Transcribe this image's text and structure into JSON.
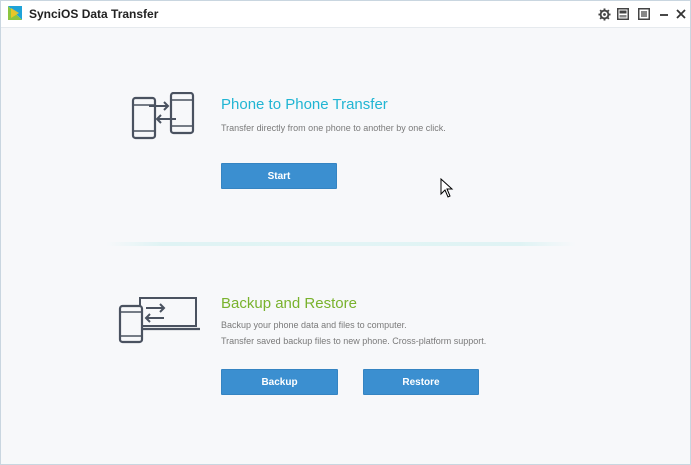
{
  "window": {
    "title": "SynciOS Data Transfer"
  },
  "titlebar_controls": {
    "icons": [
      "gear-icon",
      "skin-icon",
      "menu-icon",
      "minimize-icon",
      "close-icon"
    ]
  },
  "phone_transfer": {
    "icon": "phone-to-phone-icon",
    "title": "Phone to Phone Transfer",
    "description": "Transfer directly from one phone to another by one click.",
    "start_label": "Start",
    "title_color": "#21b5d3"
  },
  "backup_restore": {
    "icon": "phone-to-computer-icon",
    "title": "Backup and Restore",
    "description_line1": "Backup your phone data and files to computer.",
    "description_line2": "Transfer saved backup files to new phone. Cross-platform support.",
    "backup_label": "Backup",
    "restore_label": "Restore",
    "title_color": "#79b22d"
  },
  "colors": {
    "button": "#3b8fd0",
    "accent_cyan": "#21b5d3",
    "accent_green": "#79b22d"
  }
}
